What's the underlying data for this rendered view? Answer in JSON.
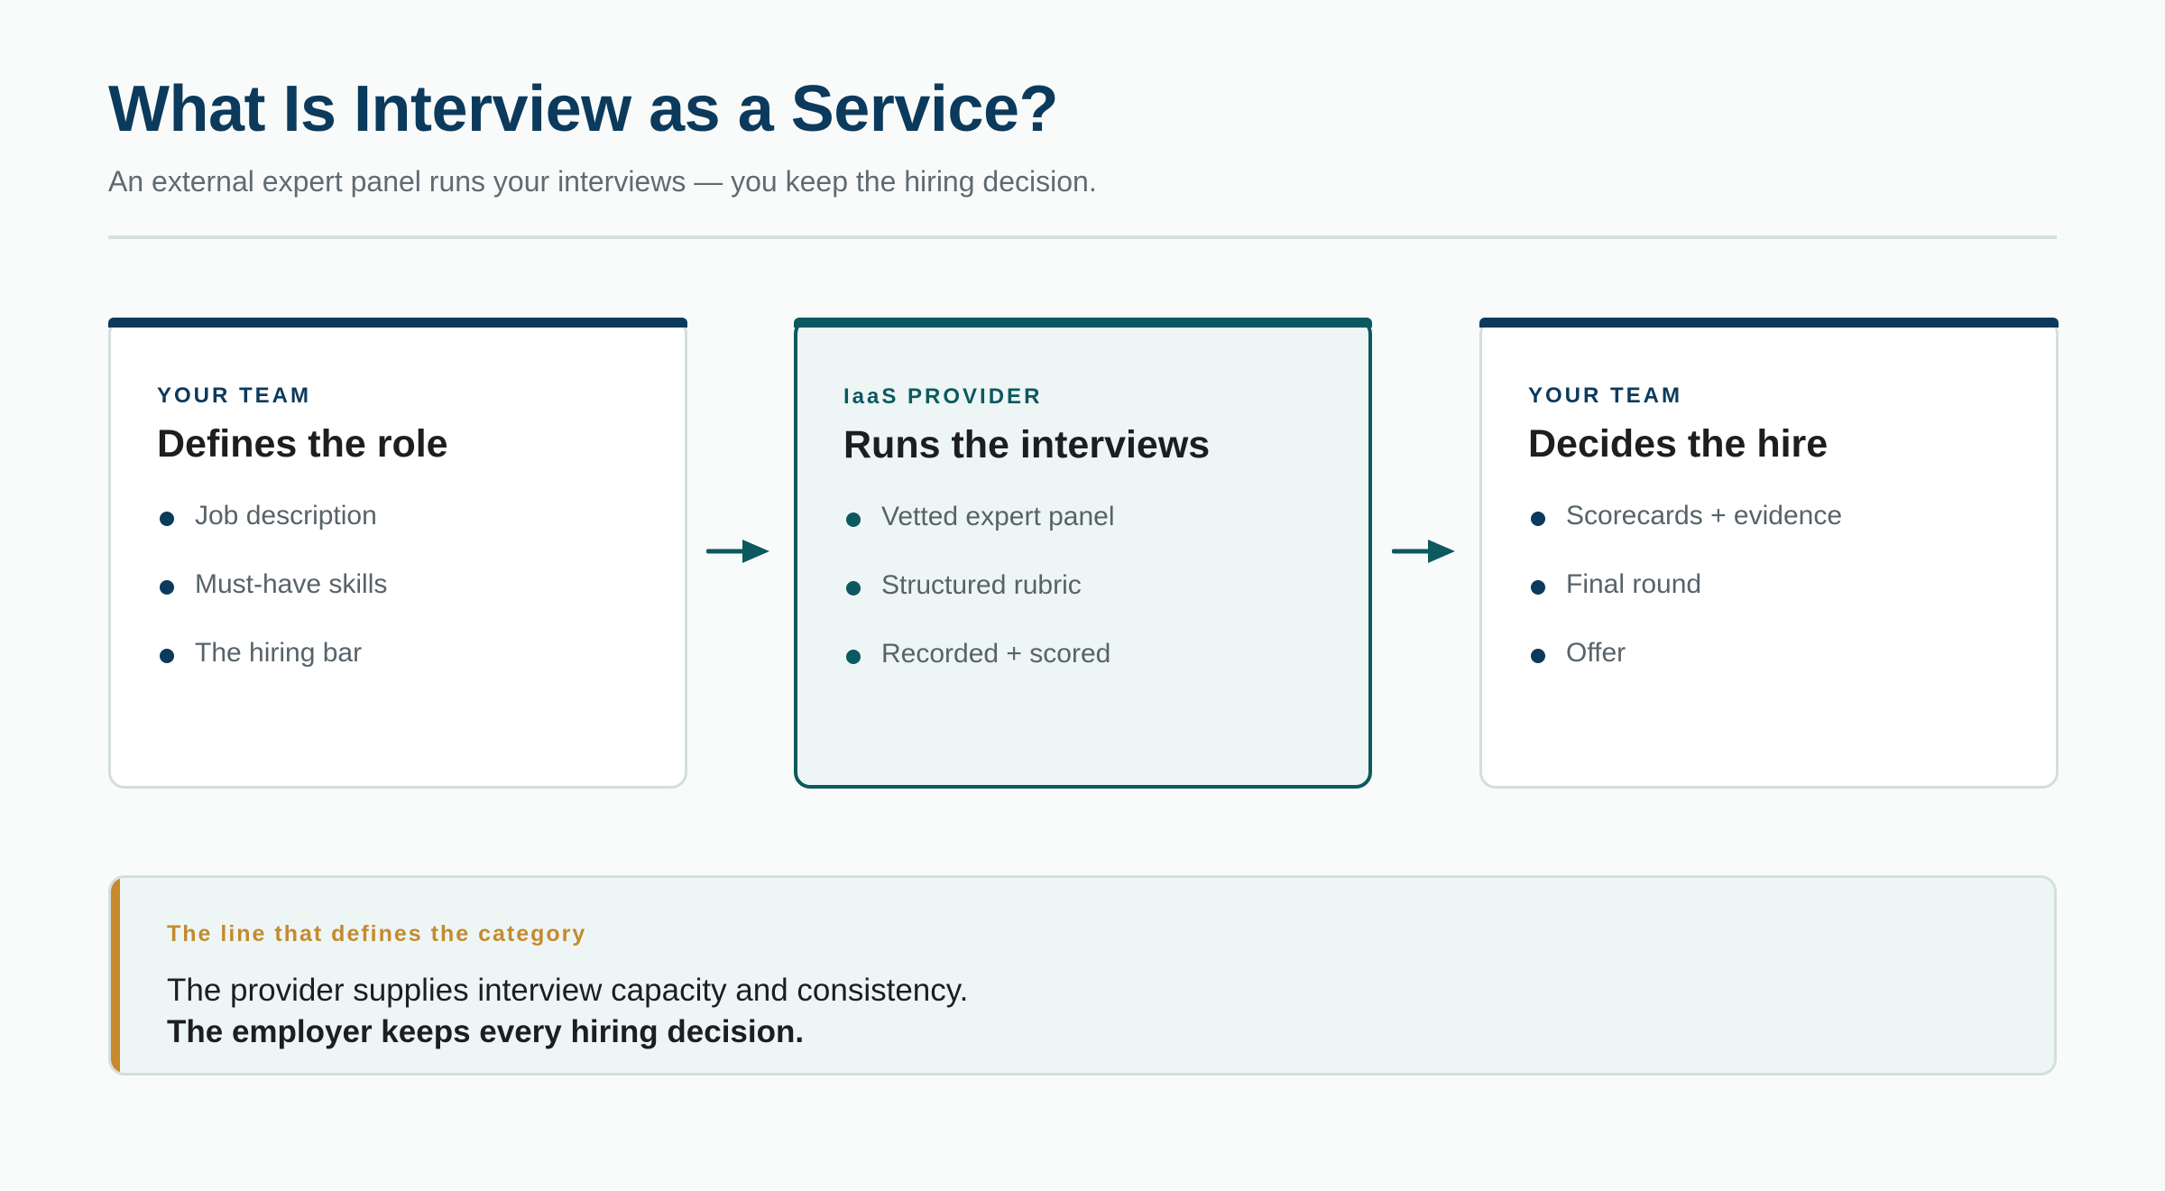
{
  "header": {
    "title": "What Is Interview as a Service?",
    "subtitle": "An external expert panel runs your interviews — you keep the hiring decision."
  },
  "steps": [
    {
      "eyebrow": "YOUR TEAM",
      "title": "Defines the role",
      "bullets": [
        "Job description",
        "Must-have skills",
        "The hiring bar"
      ]
    },
    {
      "eyebrow": "IaaS PROVIDER",
      "title": "Runs the interviews",
      "bullets": [
        "Vetted expert panel",
        "Structured rubric",
        "Recorded + scored"
      ]
    },
    {
      "eyebrow": "YOUR TEAM",
      "title": "Decides the hire",
      "bullets": [
        "Scorecards + evidence",
        "Final round",
        "Offer"
      ]
    }
  ],
  "callout": {
    "label": "The line that defines the category",
    "line1": "The provider supplies interview capacity and consistency.",
    "line2": "The employer keeps every hiring decision."
  },
  "colors": {
    "navy": "#0b3a5c",
    "teal": "#0d5960",
    "gold": "#c58a2e",
    "background": "#f9fbfa"
  },
  "icons": {
    "flow_arrow": "arrow-right-icon",
    "bullet": "bullet-dot-icon"
  }
}
